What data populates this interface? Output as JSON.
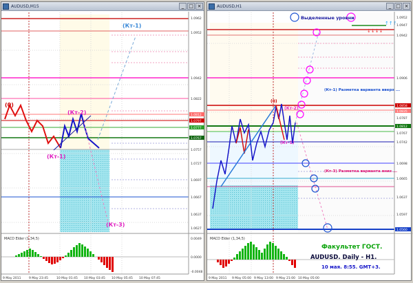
{
  "left_window": {
    "title": "AUDUSD,M15",
    "price_labels": [
      "1.0962",
      "1.0952",
      "1.0942",
      "1.0822",
      "1.0812",
      "1.0797",
      "1.0777",
      "1.0767",
      "1.0757",
      "1.0727",
      "1.0697",
      "1.0667",
      "1.0637",
      "1.0627"
    ],
    "macd_label": "MACD Elder (1,34,5)",
    "macd_scale": [
      "0.0049",
      "0.0000",
      "-0.0048"
    ],
    "time_labels": [
      "9 May 2011",
      "9 May 23:45",
      "10 May 01:45",
      "10 May 03:45",
      "10 May 05:45",
      "10 May 07:45"
    ],
    "annotations": {
      "zero": "(0)",
      "kt1": "(Кт-1)",
      "kt2": "(Кт-2)",
      "kt3": "(Кт-3)",
      "kt1_upper": "(Кт-1)"
    }
  },
  "right_window": {
    "title": "AUDUSD,H1",
    "price_labels": [
      "1.0952",
      "1.0947",
      "1.0942",
      "1.0906",
      "1.0858",
      "1.0835",
      "1.0812",
      "1.0787",
      "1.0767",
      "1.0742",
      "1.0698",
      "1.0665",
      "1.0637",
      "1.0597",
      "1.0560"
    ],
    "macd_label": "MACD Elder (1,34,5)",
    "time_labels": [
      "9 May 2011",
      "9 May 05:00",
      "9 May 13:00",
      "9 May 21:00",
      "10 May 05:00"
    ],
    "annotations": {
      "zero": "(0)",
      "kt1": "(Кт-1)",
      "kt2": "(Кт-2)",
      "levels": "Выделенные уровни",
      "markup_up": "(Кт-1) Разметка варианта вверх ...",
      "markup_down": "(Кт-3) Разметка варианта вниз ..."
    },
    "overlay": {
      "line1": "Факультет ГОСТ.",
      "line2": "AUDUSD. Daily - H1.",
      "line3": "10 мая. 8:55. GMT+3."
    }
  },
  "colors": {
    "chart_bg": "#ffffff",
    "bull_bar": "#1515c8",
    "bear_bar": "#e01010",
    "macd_green": "#11b411",
    "macd_red": "#e00000",
    "level_magenta": "#ff00ff",
    "level_red": "#c81010",
    "level_green": "#1a8a1a",
    "level_blue": "#1640c8",
    "cyan_zone": "#9fe6ef",
    "overlay_green": "#0aa30a"
  }
}
